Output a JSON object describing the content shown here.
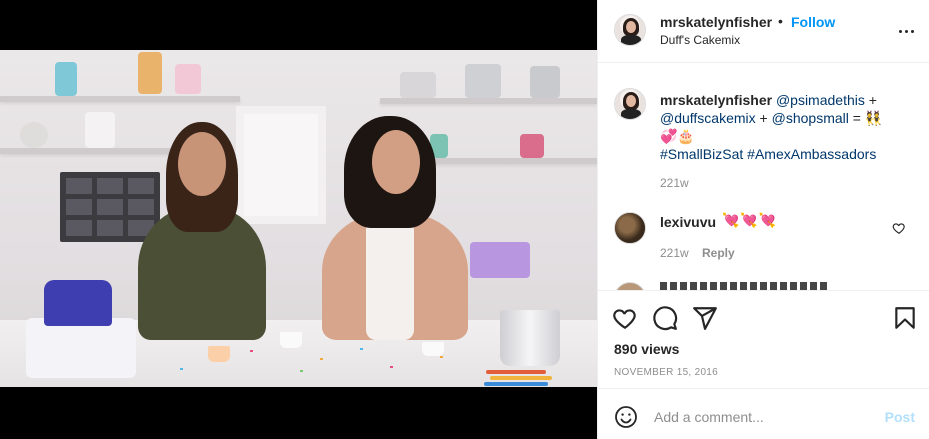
{
  "header": {
    "username": "mrskatelynfisher",
    "separator": "•",
    "follow_label": "Follow",
    "subtitle": "Duff's Cakemix",
    "more_icon": "more-horizontal-icon"
  },
  "caption": {
    "username": "mrskatelynfisher",
    "mention_1": "@psimadethis",
    "plus_1": " + ",
    "mention_2": "@duffscakemix",
    "plus_2": " + ",
    "mention_3": "@shopsmall",
    "equals": " = 👯",
    "emojis": "💞🎂",
    "hashtag_1": "#SmallBizSat",
    "hashtag_2": "#AmexAmbassadors",
    "time": "221w"
  },
  "comment": {
    "username": "lexivuvu",
    "text": "💘💘💘",
    "time": "221w",
    "reply_label": "Reply",
    "like_icon": "heart-outline-icon"
  },
  "actions": {
    "like_icon": "heart-icon",
    "comment_icon": "comment-icon",
    "share_icon": "share-icon",
    "save_icon": "bookmark-icon",
    "views": "890 views",
    "date": "NOVEMBER 15, 2016"
  },
  "comment_box": {
    "placeholder": "Add a comment...",
    "post_label": "Post",
    "emoji_icon": "emoji-icon"
  },
  "video": {
    "mute_icon": "muted-speaker-icon"
  },
  "colors": {
    "link_blue": "#0095f6",
    "mention_navy": "#00376b",
    "post_disabled": "#b2dffc",
    "secondary_text": "#8e8e8e"
  }
}
